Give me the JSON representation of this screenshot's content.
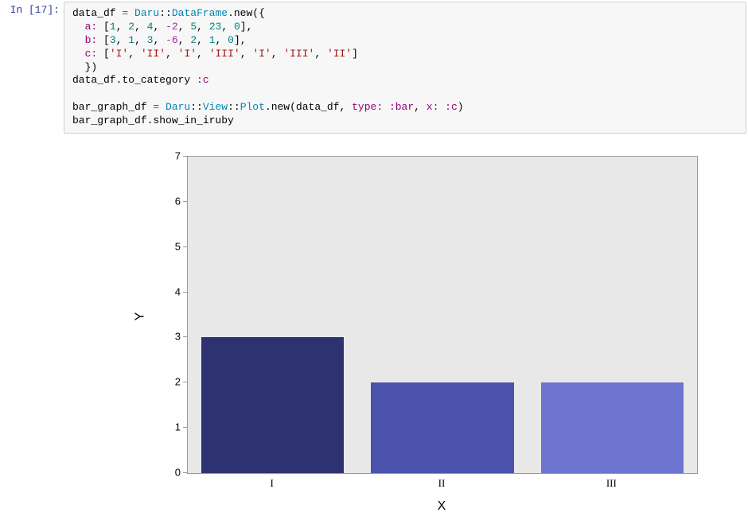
{
  "prompt": "In [17]:",
  "code": {
    "l1_a": "data_df ",
    "l1_b": "= ",
    "l1_c": "Daru",
    "l1_d": "::",
    "l1_e": "DataFrame",
    "l1_f": ".new({",
    "l2_a": "  a: ",
    "l2_b": "[",
    "l2_n1": "1",
    "l2_c": ", ",
    "l2_n2": "2",
    "l2_n3": "4",
    "l2_n4": "-2",
    "l2_n5": "5",
    "l2_n6": "23",
    "l2_n7": "0",
    "l2_close": "],",
    "l3_a": "  b: ",
    "l3_n1": "3",
    "l3_n2": "1",
    "l3_n3": "3",
    "l3_n4": "-6",
    "l3_n5": "2",
    "l3_n6": "1",
    "l3_n7": "0",
    "l4_a": "  c: ",
    "l4_s1": "'I'",
    "l4_s2": "'II'",
    "l4_s3": "'I'",
    "l4_s4": "'III'",
    "l4_s5": "'I'",
    "l4_s6": "'III'",
    "l4_s7": "'II'",
    "l4_close": "]",
    "l5": "  })",
    "l6_a": "data_df.to_category ",
    "l6_b": ":c",
    "l8_a": "bar_graph_df ",
    "l8_b": "= ",
    "l8_c": "Daru",
    "l8_d": "::",
    "l8_e": "View",
    "l8_f": "::",
    "l8_g": "Plot",
    "l8_h": ".new(data_df, ",
    "l8_i": "type: ",
    "l8_j": ":bar",
    "l8_k": ", ",
    "l8_l": "x: ",
    "l8_m": ":c",
    "l8_n": ")",
    "l9": "bar_graph_df.show_in_iruby"
  },
  "chart_data": {
    "type": "bar",
    "categories": [
      "I",
      "II",
      "III"
    ],
    "values": [
      3,
      2,
      2
    ],
    "xlabel": "X",
    "ylabel": "Y",
    "ylim": [
      0,
      7
    ],
    "yticks": [
      0,
      1,
      2,
      3,
      4,
      5,
      6,
      7
    ],
    "colors": [
      "#2f3270",
      "#4b52ab",
      "#6d74cf"
    ]
  }
}
